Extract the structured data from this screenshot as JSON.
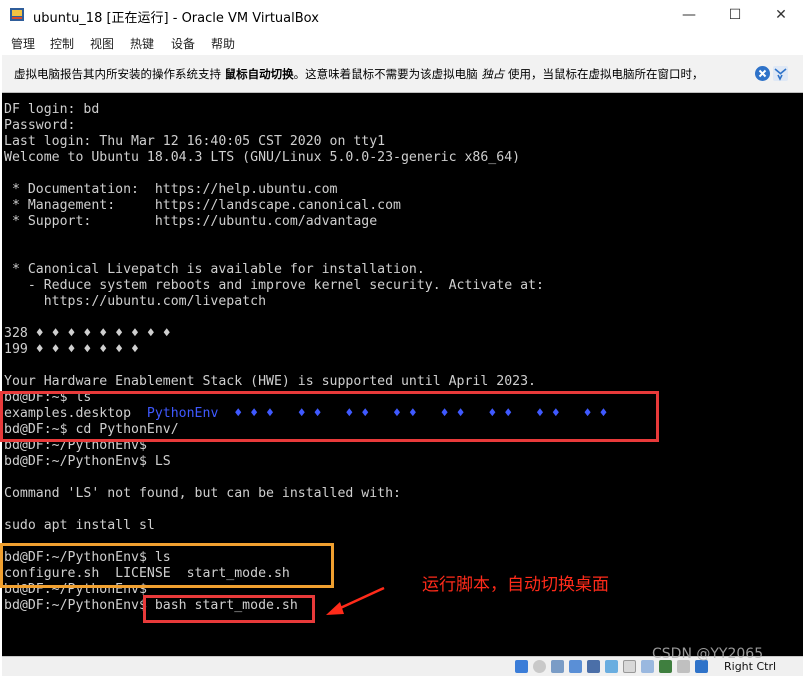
{
  "window": {
    "title": "ubuntu_18 [正在运行] - Oracle VM VirtualBox",
    "minimize_glyph": "—",
    "maximize_glyph": "☐",
    "close_glyph": "✕"
  },
  "menu": [
    "管理",
    "控制",
    "视图",
    "热键",
    "设备",
    "帮助"
  ],
  "notification": {
    "text_before": "虚拟电脑报告其内所安装的操作系统支持 ",
    "bold": "鼠标自动切换",
    "text_middle": "。这意味着鼠标不需要为该虚拟电脑 ",
    "italic": "独占",
    "text_after": " 使用，当鼠标在虚拟电脑所在窗口时，"
  },
  "terminal": {
    "lines": [
      "DF login: bd",
      "Password:",
      "Last login: Thu Mar 12 16:40:05 CST 2020 on tty1",
      "Welcome to Ubuntu 18.04.3 LTS (GNU/Linux 5.0.0-23-generic x86_64)",
      "",
      " * Documentation:  https://help.ubuntu.com",
      " * Management:     https://landscape.canonical.com",
      " * Support:        https://ubuntu.com/advantage",
      "",
      "",
      " * Canonical Livepatch is available for installation.",
      "   - Reduce system reboots and improve kernel security. Activate at:",
      "     https://ubuntu.com/livepatch",
      "",
      "328 ♦ ♦ ♦ ♦ ♦ ♦ ♦ ♦ ♦",
      "199 ♦ ♦ ♦ ♦ ♦ ♦ ♦",
      "",
      "Your Hardware Enablement Stack (HWE) is supported until April 2023.",
      "bd@DF:~$ ls",
      "examples.desktop  ",
      "bd@DF:~$ cd PythonEnv/",
      "bd@DF:~/PythonEnv$",
      "bd@DF:~/PythonEnv$ LS",
      "",
      "Command 'LS' not found, but can be installed with:",
      "",
      "sudo apt install sl",
      "",
      "bd@DF:~/PythonEnv$ ls",
      "configure.sh  LICENSE  start_mode.sh",
      "bd@DF:~/PythonEnv$",
      "bd@DF:~/PythonEnv$ bash start_mode.sh"
    ],
    "blue_suffix": "PythonEnv  ♦ ♦ ♦   ♦ ♦   ♦ ♦   ♦ ♦   ♦ ♦   ♦ ♦   ♦ ♦   ♦ ♦"
  },
  "annotation": "运行脚本，自动切换桌面",
  "statusbar": {
    "host_key": "Right Ctrl"
  },
  "watermark": "CSDN @YY2065",
  "colors": {
    "highlight_red": "#e83a3a",
    "highlight_orange": "#f0a030",
    "annotation_red": "#ff2b1a"
  }
}
